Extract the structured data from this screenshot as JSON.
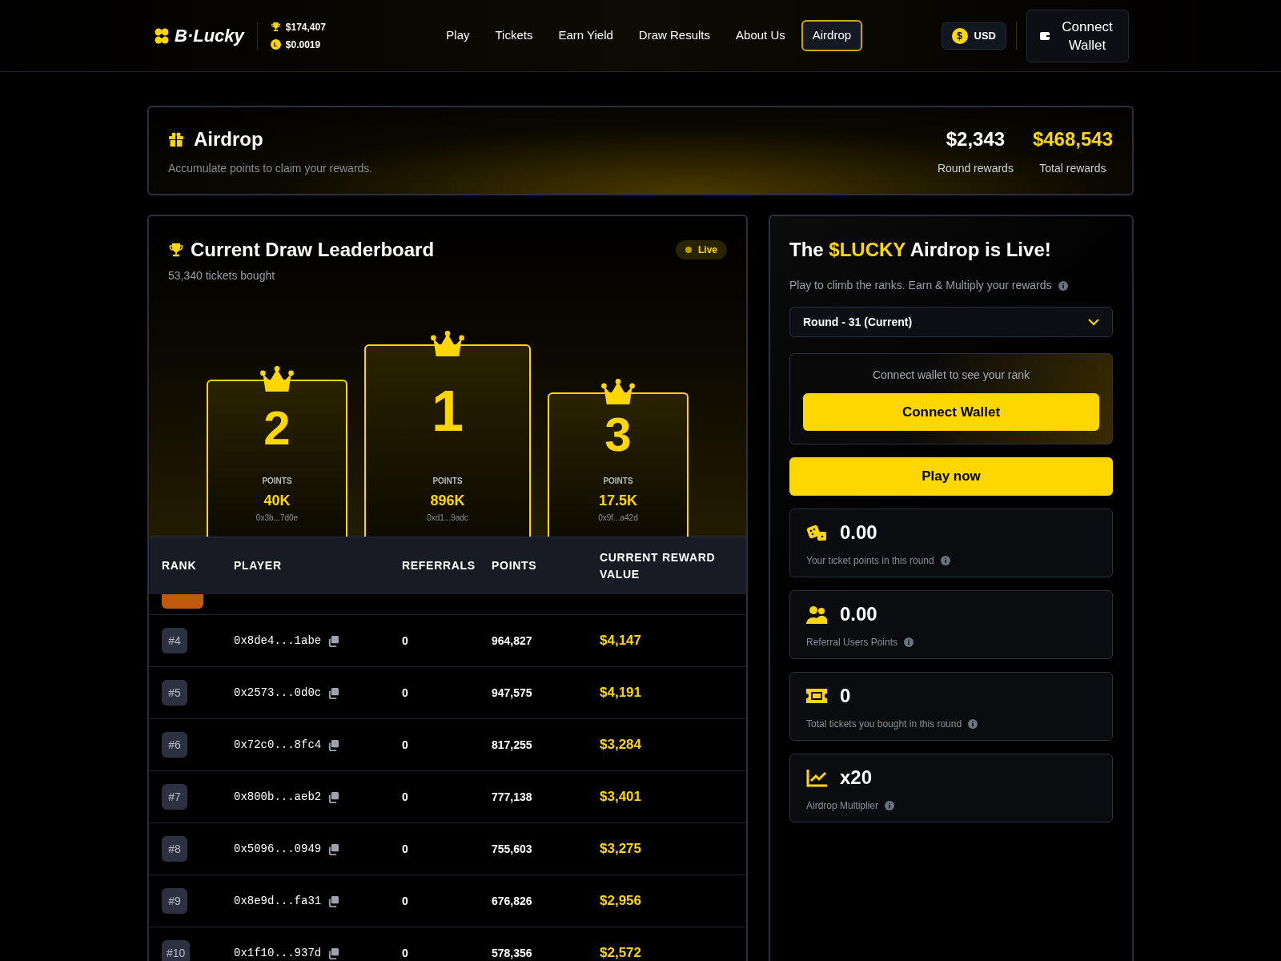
{
  "header": {
    "logo": "B·Lucky",
    "stats": [
      {
        "kind": "trophy",
        "value": "$174,407"
      },
      {
        "kind": "token",
        "badge": "L",
        "value": "$0.0019"
      }
    ],
    "nav": [
      {
        "label": "Play",
        "selected": false
      },
      {
        "label": "Tickets",
        "selected": false
      },
      {
        "label": "Earn Yield",
        "selected": false
      },
      {
        "label": "Draw Results",
        "selected": false
      },
      {
        "label": "About Us",
        "selected": false
      },
      {
        "label": "Airdrop",
        "selected": true
      }
    ],
    "currency": {
      "symbol": "$",
      "label": "USD"
    },
    "connect_button": "Connect Wallet"
  },
  "banner": {
    "title": "Airdrop",
    "subtitle": "Accumulate points to claim your rewards.",
    "stats": [
      {
        "value": "$2,343",
        "label": "Round rewards",
        "highlight": false
      },
      {
        "value": "$468,543",
        "label": "Total rewards",
        "highlight": true
      }
    ]
  },
  "leaderboard": {
    "title": "Current Draw Leaderboard",
    "subtitle": "53,340 tickets bought",
    "status": "Live",
    "podium": [
      {
        "place": "2",
        "label": "POINTS",
        "points": "40K",
        "address": "0x3b...7d0e"
      },
      {
        "place": "1",
        "label": "POINTS",
        "points": "896K",
        "address": "0xd1...9adc"
      },
      {
        "place": "3",
        "label": "POINTS",
        "points": "17.5K",
        "address": "0x9f...a42d"
      }
    ],
    "table": {
      "columns": [
        "RANK",
        "PLAYER",
        "REFERRALS",
        "POINTS",
        "CURRENT REWARD VALUE"
      ],
      "rows": [
        {
          "rank": "#4",
          "player": "0x8de4...1abe",
          "referrals": "0",
          "points": "964,827",
          "reward": "$4,147"
        },
        {
          "rank": "#5",
          "player": "0x2573...0d0c",
          "referrals": "0",
          "points": "947,575",
          "reward": "$4,191"
        },
        {
          "rank": "#6",
          "player": "0x72c0...8fc4",
          "referrals": "0",
          "points": "817,255",
          "reward": "$3,284"
        },
        {
          "rank": "#7",
          "player": "0x800b...aeb2",
          "referrals": "0",
          "points": "777,138",
          "reward": "$3,401"
        },
        {
          "rank": "#8",
          "player": "0x5096...0949",
          "referrals": "0",
          "points": "755,603",
          "reward": "$3,275"
        },
        {
          "rank": "#9",
          "player": "0x8e9d...fa31",
          "referrals": "0",
          "points": "676,826",
          "reward": "$2,956"
        },
        {
          "rank": "#10",
          "player": "0x1f10...937d",
          "referrals": "0",
          "points": "578,356",
          "reward": "$2,572"
        }
      ]
    }
  },
  "airdrop_panel": {
    "title_parts": [
      {
        "text": "The ",
        "highlight": false
      },
      {
        "text": "$LUCKY",
        "highlight": true
      },
      {
        "text": " Airdrop is Live!",
        "highlight": false
      }
    ],
    "description": "Play to climb the ranks. Earn & Multiply your rewards",
    "round_select": "Round - 31 (Current)",
    "rank_prompt": "Connect wallet to see your rank",
    "connect_button": "Connect Wallet",
    "play_button": "Play now",
    "stats": [
      {
        "kind": "dice",
        "value": "0.00",
        "label": "Your ticket points in this round"
      },
      {
        "kind": "users",
        "value": "0.00",
        "label": "Referral Users Points"
      },
      {
        "kind": "ticket",
        "value": "0",
        "label": "Total tickets you bought in this round"
      },
      {
        "kind": "chart",
        "value": "x20",
        "label": "Airdrop Multiplier"
      }
    ]
  }
}
